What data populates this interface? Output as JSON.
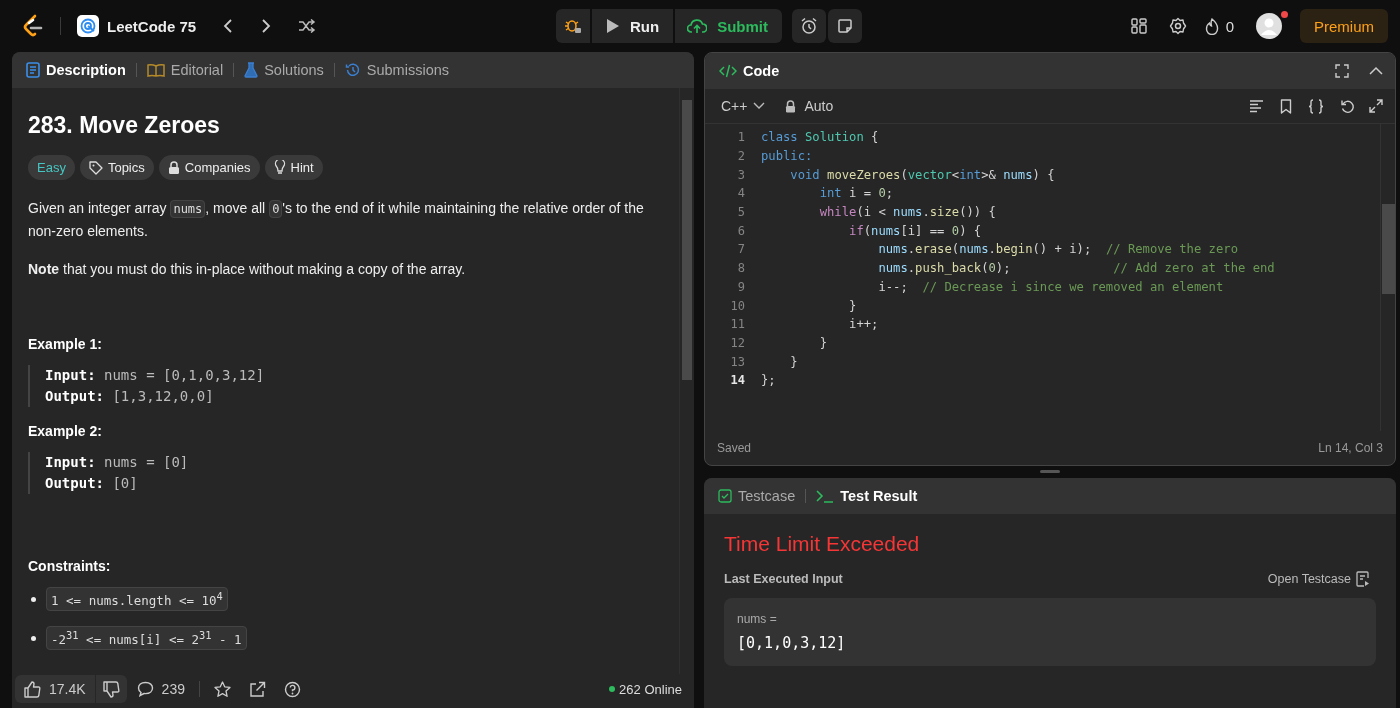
{
  "topbar": {
    "list_title": "LeetCode 75",
    "run_label": "Run",
    "submit_label": "Submit",
    "streak": "0",
    "premium_label": "Premium",
    "has_notification": true
  },
  "description_panel": {
    "tabs": [
      {
        "label": "Description",
        "kind": "description",
        "selected": true
      },
      {
        "label": "Editorial",
        "kind": "editorial",
        "selected": false
      },
      {
        "label": "Solutions",
        "kind": "solutions",
        "selected": false
      },
      {
        "label": "Submissions",
        "kind": "submissions",
        "selected": false
      }
    ],
    "title": "283. Move Zeroes",
    "tags": [
      {
        "label": "Easy",
        "kind": "difficulty"
      },
      {
        "label": "Topics",
        "kind": "topics"
      },
      {
        "label": "Companies",
        "kind": "companies"
      },
      {
        "label": "Hint",
        "kind": "hint"
      }
    ],
    "statement": [
      {
        "text": "Given an integer array "
      },
      {
        "code": "nums"
      },
      {
        "text": ", move all "
      },
      {
        "code": "0"
      },
      {
        "text": "'s to the end of it while maintaining the relative order of the non-zero elements."
      }
    ],
    "note": "**Note** that you must do this in-place without making a copy of the array.",
    "examples": [
      {
        "title": "Example 1:",
        "lines": [
          "**Input:** nums = [0,1,0,3,12]",
          "**Output:** [1,3,12,0,0]"
        ]
      },
      {
        "title": "Example 2:",
        "lines": [
          "**Input:** nums = [0]",
          "**Output:** [0]"
        ]
      }
    ],
    "constraints_title": "Constraints:",
    "constraints": [
      "1 <= nums.length <= 10$^{4}$",
      "-2$^{31}$ <= nums[i] <= 2$^{31}$ - 1"
    ],
    "footer": {
      "likes": "17.4K",
      "comments": "239",
      "online": "262 Online"
    }
  },
  "code_panel": {
    "title": "Code",
    "language": "C++",
    "mode": "Auto",
    "status": "Saved",
    "cursor": "Ln 14, Col 3",
    "lines": [
      {
        "n": "1",
        "current": false,
        "tokens": [
          {
            "t": "class ",
            "kind": "kw"
          },
          {
            "t": "Solution",
            "kind": "type"
          },
          {
            "t": " {",
            "kind": "p"
          }
        ]
      },
      {
        "n": "2",
        "current": false,
        "tokens": [
          {
            "t": "public:",
            "kind": "kw"
          }
        ]
      },
      {
        "n": "3",
        "current": false,
        "tokens": [
          {
            "t": "    void ",
            "kind": "kw"
          },
          {
            "t": "moveZeroes",
            "kind": "fn"
          },
          {
            "t": "(",
            "kind": "p"
          },
          {
            "t": "vector",
            "kind": "type"
          },
          {
            "t": "<",
            "kind": "p"
          },
          {
            "t": "int",
            "kind": "kw"
          },
          {
            "t": ">& ",
            "kind": "p"
          },
          {
            "t": "nums",
            "kind": "var"
          },
          {
            "t": ") {",
            "kind": "p"
          }
        ]
      },
      {
        "n": "4",
        "current": false,
        "tokens": [
          {
            "t": "        int ",
            "kind": "kw"
          },
          {
            "t": "i = ",
            "kind": "p"
          },
          {
            "t": "0",
            "kind": "num"
          },
          {
            "t": ";",
            "kind": "p"
          }
        ]
      },
      {
        "n": "5",
        "current": false,
        "tokens": [
          {
            "t": "        while",
            "kind": "ctrl"
          },
          {
            "t": "(i < ",
            "kind": "p"
          },
          {
            "t": "nums",
            "kind": "var"
          },
          {
            "t": ".",
            "kind": "p"
          },
          {
            "t": "size",
            "kind": "fn"
          },
          {
            "t": "()) {",
            "kind": "p"
          }
        ]
      },
      {
        "n": "6",
        "current": false,
        "tokens": [
          {
            "t": "            if",
            "kind": "ctrl"
          },
          {
            "t": "(",
            "kind": "p"
          },
          {
            "t": "nums",
            "kind": "var"
          },
          {
            "t": "[i] == ",
            "kind": "p"
          },
          {
            "t": "0",
            "kind": "num"
          },
          {
            "t": ") {",
            "kind": "p"
          }
        ]
      },
      {
        "n": "7",
        "current": false,
        "tokens": [
          {
            "t": "                nums",
            "kind": "var"
          },
          {
            "t": ".",
            "kind": "p"
          },
          {
            "t": "erase",
            "kind": "fn"
          },
          {
            "t": "(",
            "kind": "p"
          },
          {
            "t": "nums",
            "kind": "var"
          },
          {
            "t": ".",
            "kind": "p"
          },
          {
            "t": "begin",
            "kind": "fn"
          },
          {
            "t": "() + i);  ",
            "kind": "p"
          },
          {
            "t": "// Remove the zero",
            "kind": "cm"
          }
        ]
      },
      {
        "n": "8",
        "current": false,
        "tokens": [
          {
            "t": "                nums",
            "kind": "var"
          },
          {
            "t": ".",
            "kind": "p"
          },
          {
            "t": "push_back",
            "kind": "fn"
          },
          {
            "t": "(",
            "kind": "p"
          },
          {
            "t": "0",
            "kind": "num"
          },
          {
            "t": ");              ",
            "kind": "p"
          },
          {
            "t": "// Add zero at the end",
            "kind": "cm"
          }
        ]
      },
      {
        "n": "9",
        "current": false,
        "tokens": [
          {
            "t": "                i--;  ",
            "kind": "p"
          },
          {
            "t": "// Decrease i since we removed an element",
            "kind": "cm"
          }
        ]
      },
      {
        "n": "10",
        "current": false,
        "tokens": [
          {
            "t": "            }",
            "kind": "p"
          }
        ]
      },
      {
        "n": "11",
        "current": false,
        "tokens": [
          {
            "t": "            i++;",
            "kind": "p"
          }
        ]
      },
      {
        "n": "12",
        "current": false,
        "tokens": [
          {
            "t": "        }",
            "kind": "p"
          }
        ]
      },
      {
        "n": "13",
        "current": false,
        "tokens": [
          {
            "t": "    }",
            "kind": "p"
          }
        ]
      },
      {
        "n": "14",
        "current": true,
        "tokens": [
          {
            "t": "};",
            "kind": "p"
          }
        ]
      }
    ]
  },
  "result_panel": {
    "tabs": [
      {
        "label": "Testcase",
        "kind": "testcase",
        "selected": false
      },
      {
        "label": "Test Result",
        "kind": "result",
        "selected": true
      }
    ],
    "verdict": "Time Limit Exceeded",
    "input_label": "Last Executed Input",
    "open_testcase": "Open Testcase",
    "param_name": "nums =",
    "param_value": "[0,1,0,3,12]"
  }
}
